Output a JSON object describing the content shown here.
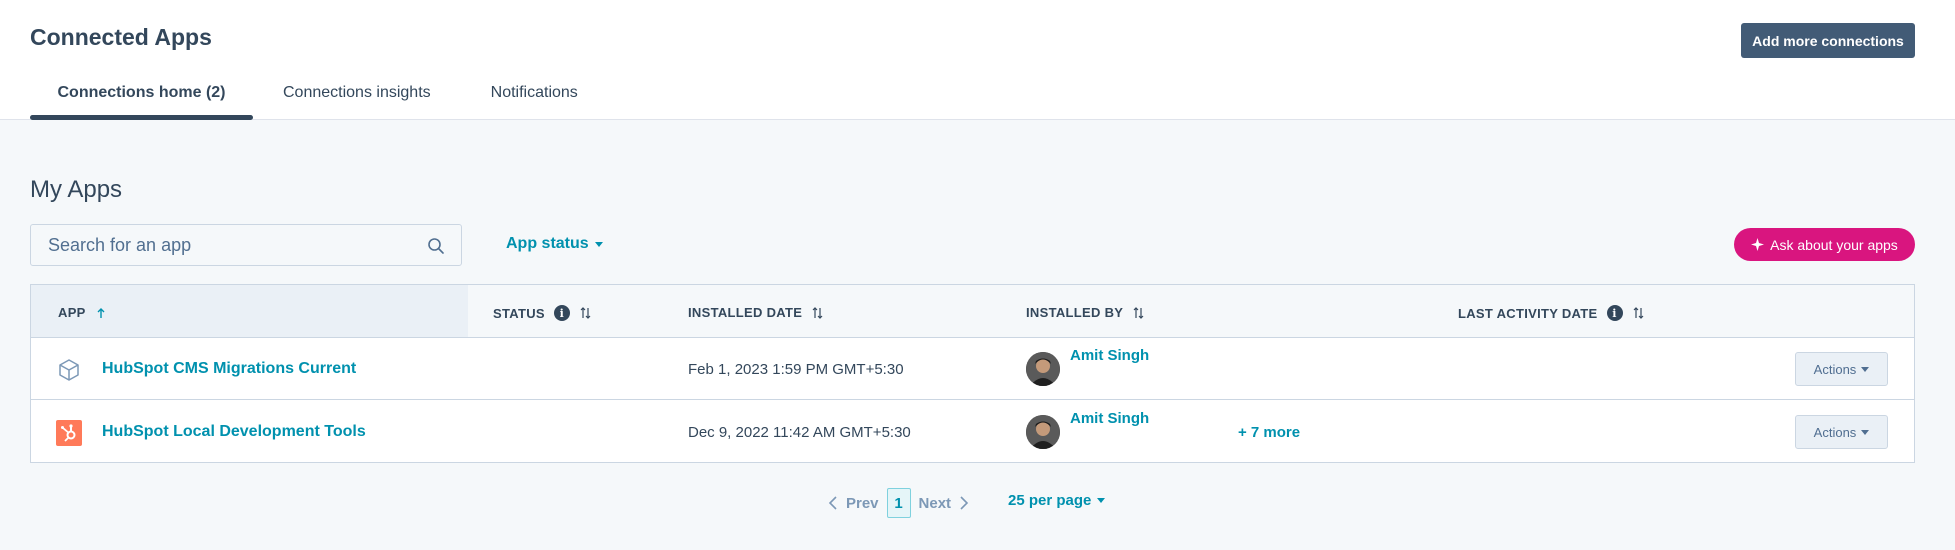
{
  "header": {
    "title": "Connected Apps",
    "add_button": "Add more connections",
    "tabs": [
      {
        "label": "Connections home (2)",
        "active": true
      },
      {
        "label": "Connections insights",
        "active": false
      },
      {
        "label": "Notifications",
        "active": false
      }
    ]
  },
  "main": {
    "section_title": "My Apps",
    "search_placeholder": "Search for an app",
    "status_filter": "App status",
    "ask_button": "Ask about your apps"
  },
  "table": {
    "columns": [
      "APP",
      "STATUS",
      "INSTALLED DATE",
      "INSTALLED BY",
      "LAST ACTIVITY DATE"
    ],
    "rows": [
      {
        "icon": "cube-icon",
        "app": "HubSpot CMS Migrations Current",
        "status": "",
        "installed_date": "Feb 1, 2023 1:59 PM GMT+5:30",
        "installed_by": "Amit Singh",
        "more": "",
        "last_activity": "",
        "actions": "Actions"
      },
      {
        "icon": "hubspot-logo-icon",
        "app": "HubSpot Local Development Tools",
        "status": "",
        "installed_date": "Dec 9, 2022 11:42 AM GMT+5:30",
        "installed_by": "Amit Singh",
        "more": "+ 7 more",
        "last_activity": "",
        "actions": "Actions"
      }
    ]
  },
  "pagination": {
    "prev": "Prev",
    "current": "1",
    "next": "Next",
    "per_page": "25 per page"
  },
  "colors": {
    "accent": "#0091ae",
    "primary_button": "#425b76",
    "ai_button": "#d9157f",
    "hubspot_orange": "#ff7a59"
  }
}
